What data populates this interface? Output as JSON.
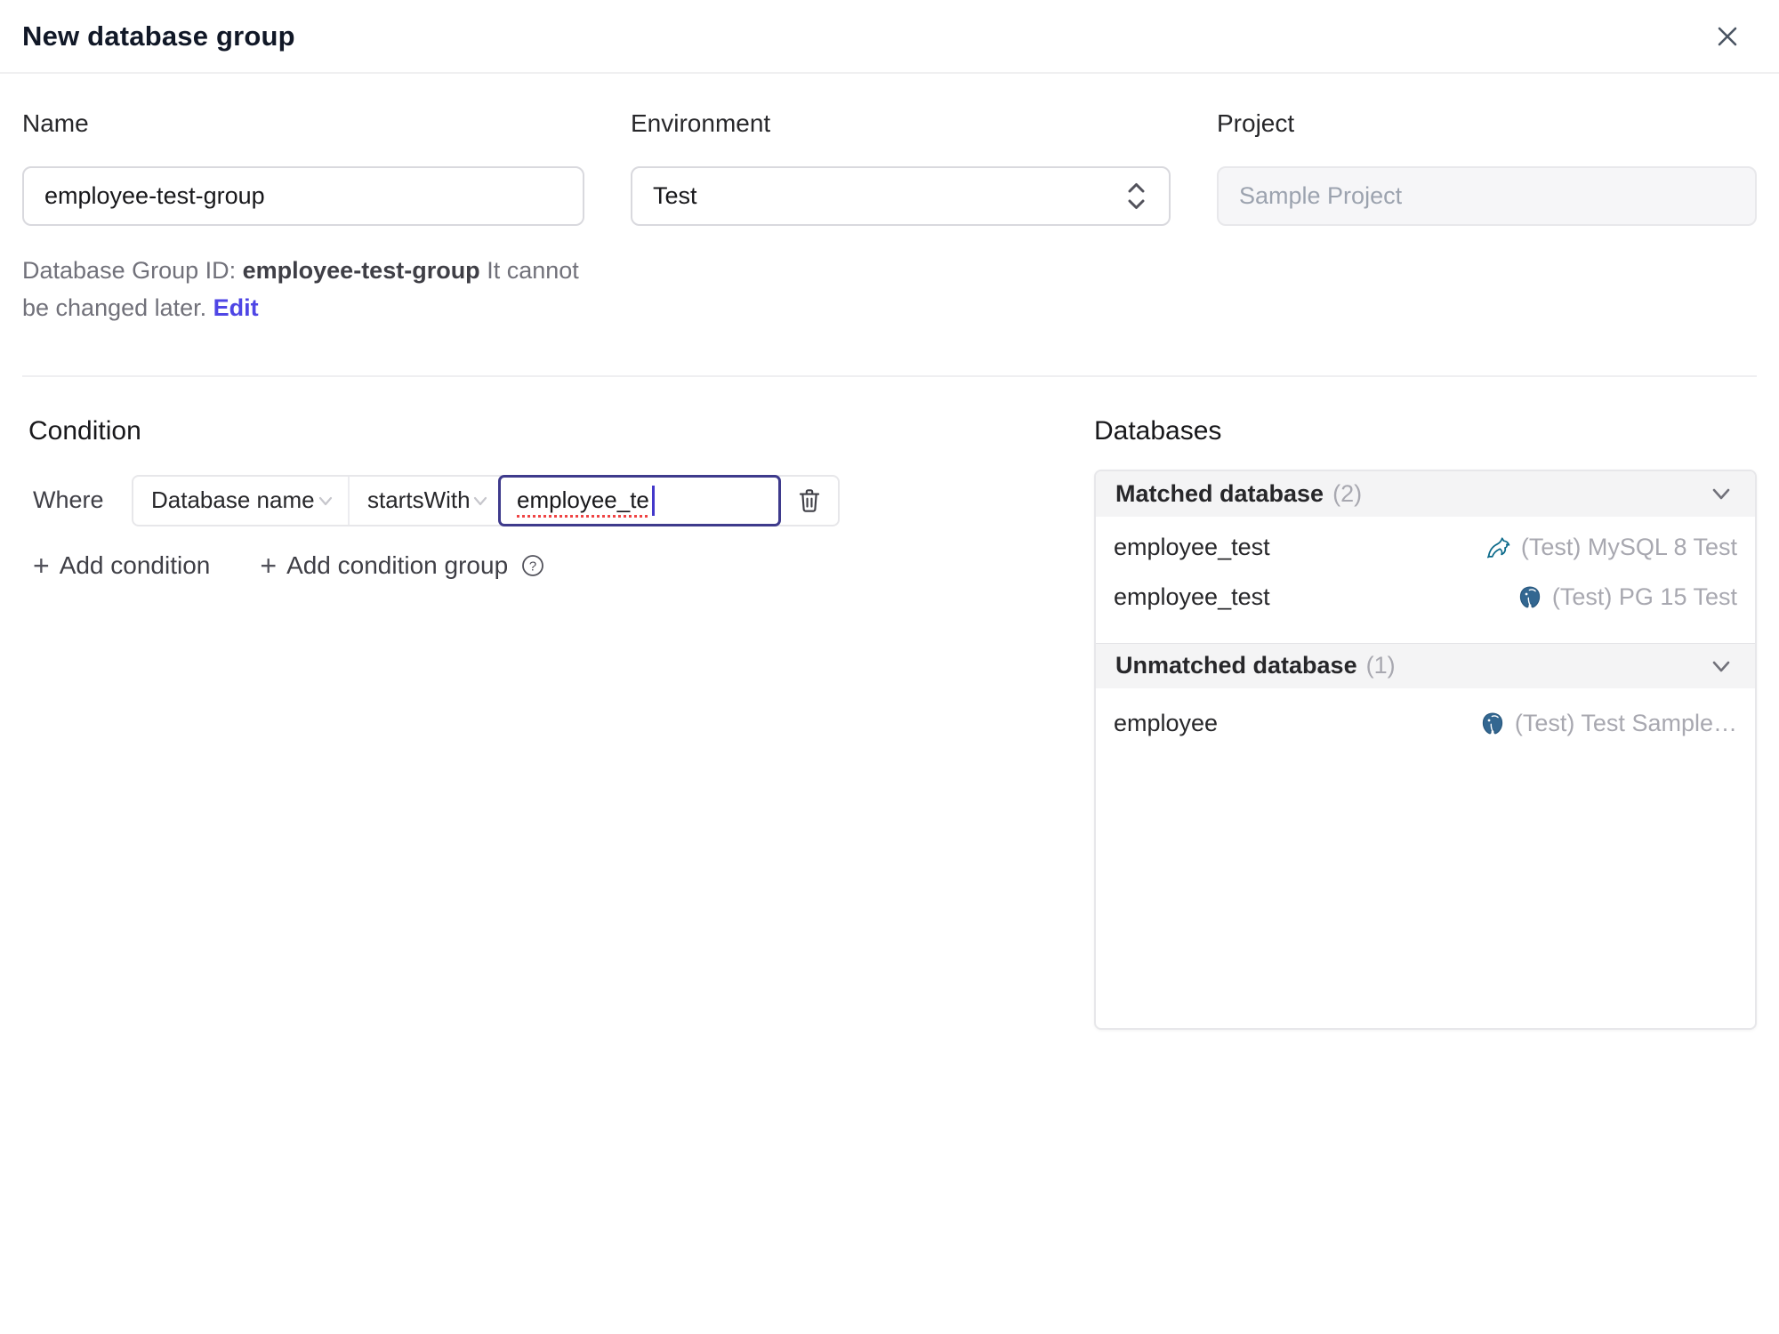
{
  "window": {
    "title": "New database group"
  },
  "form": {
    "name": {
      "label": "Name",
      "value": "employee-test-group"
    },
    "environment": {
      "label": "Environment",
      "value": "Test"
    },
    "project": {
      "label": "Project",
      "value": "Sample Project"
    },
    "group_id_note": {
      "prefix": "Database Group ID: ",
      "id": "employee-test-group",
      "suffix": " It cannot be changed later. ",
      "edit_link": "Edit"
    }
  },
  "condition": {
    "heading": "Condition",
    "where_label": "Where",
    "factor": "Database name",
    "operator": "startsWith",
    "value": "employee_te",
    "add_condition": {
      "icon": "+",
      "label": "Add condition"
    },
    "add_condition_group": {
      "icon": "+",
      "label": "Add condition group",
      "help_icon": "?"
    }
  },
  "databases": {
    "heading": "Databases",
    "sections": [
      {
        "label": "Matched database",
        "count": "(2)",
        "rows": [
          {
            "name": "employee_test",
            "engine": "mysql",
            "instance": "(Test) MySQL 8 Test"
          },
          {
            "name": "employee_test",
            "engine": "postgres",
            "instance": "(Test) PG 15 Test"
          }
        ]
      },
      {
        "label": "Unmatched database",
        "count": "(1)",
        "rows": [
          {
            "name": "employee",
            "engine": "postgres",
            "instance": "(Test) Test Sample…"
          }
        ]
      }
    ]
  },
  "colors": {
    "accent_indigo": "#4f46e5",
    "focus_border": "#3e3a8c",
    "spellcheck_red": "#ef4444",
    "mysql_teal": "#0c6a8a",
    "postgres_blue": "#336791",
    "muted_text": "#a8a8b0",
    "section_header_bg": "#f4f4f5"
  }
}
